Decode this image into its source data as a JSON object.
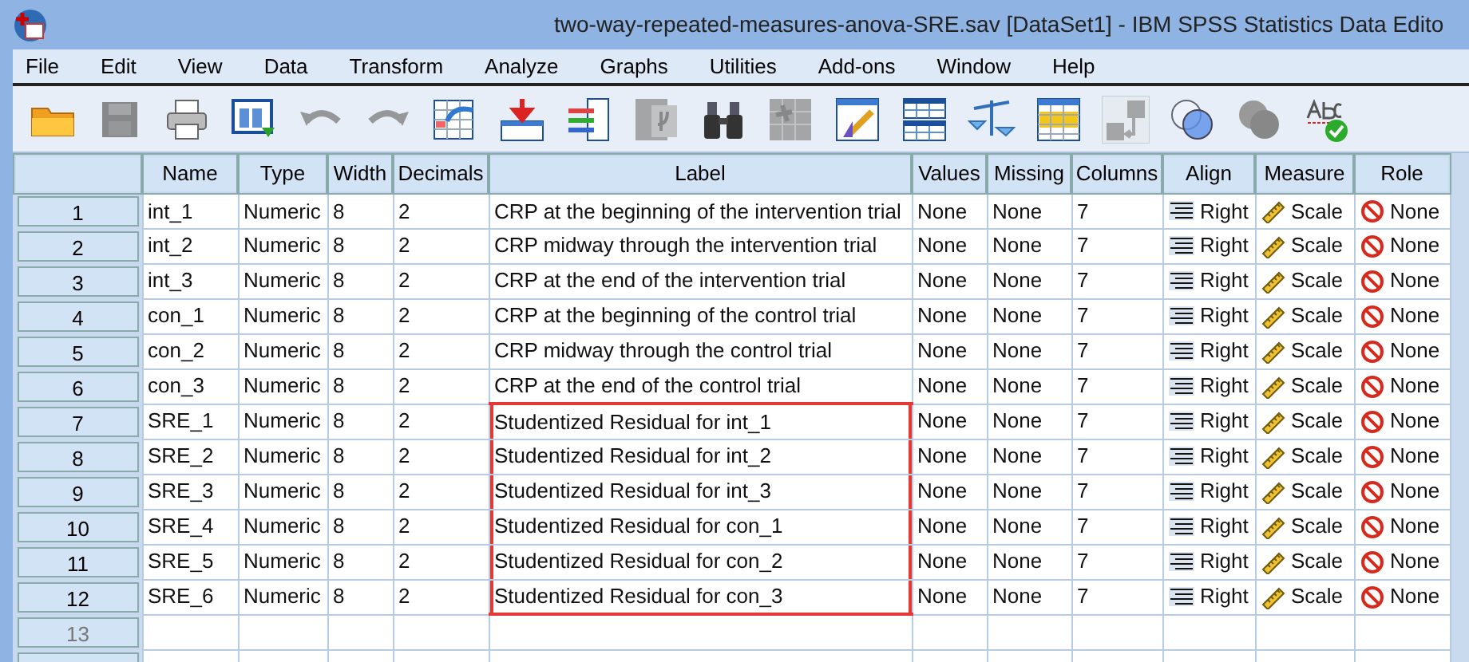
{
  "window": {
    "title": "two-way-repeated-measures-anova-SRE.sav [DataSet1] - IBM SPSS Statistics Data Edito"
  },
  "menu": [
    "File",
    "Edit",
    "View",
    "Data",
    "Transform",
    "Analyze",
    "Graphs",
    "Utilities",
    "Add-ons",
    "Window",
    "Help"
  ],
  "toolbar": [
    {
      "kind": "folder",
      "disabled": false
    },
    {
      "kind": "save",
      "disabled": true
    },
    {
      "kind": "print",
      "disabled": false
    },
    {
      "kind": "dialog",
      "disabled": false
    },
    {
      "kind": "undo",
      "disabled": true
    },
    {
      "kind": "redo",
      "disabled": true
    },
    {
      "kind": "goto",
      "disabled": false
    },
    {
      "kind": "insert",
      "disabled": false
    },
    {
      "kind": "variables",
      "disabled": false
    },
    {
      "kind": "mu",
      "disabled": true
    },
    {
      "kind": "find",
      "disabled": false
    },
    {
      "kind": "star",
      "disabled": true
    },
    {
      "kind": "pencil",
      "disabled": false
    },
    {
      "kind": "split",
      "disabled": false
    },
    {
      "kind": "scales",
      "disabled": false
    },
    {
      "kind": "select",
      "disabled": false
    },
    {
      "kind": "labels",
      "disabled": true
    },
    {
      "kind": "sets",
      "disabled": false
    },
    {
      "kind": "sets",
      "disabled": true
    },
    {
      "kind": "spell",
      "disabled": false
    }
  ],
  "table": {
    "columns": [
      "Name",
      "Type",
      "Width",
      "Decimals",
      "Label",
      "Values",
      "Missing",
      "Columns",
      "Align",
      "Measure",
      "Role"
    ],
    "rows": [
      {
        "number": "1",
        "cells": [
          "int_1",
          "Numeric",
          "8",
          "2",
          "CRP at the beginning of the intervention trial",
          "None",
          "None",
          "7",
          "Right",
          "Scale",
          "None"
        ],
        "outlined": false
      },
      {
        "number": "2",
        "cells": [
          "int_2",
          "Numeric",
          "8",
          "2",
          "CRP midway through the intervention trial",
          "None",
          "None",
          "7",
          "Right",
          "Scale",
          "None"
        ],
        "outlined": false
      },
      {
        "number": "3",
        "cells": [
          "int_3",
          "Numeric",
          "8",
          "2",
          "CRP at the end of the intervention trial",
          "None",
          "None",
          "7",
          "Right",
          "Scale",
          "None"
        ],
        "outlined": false
      },
      {
        "number": "4",
        "cells": [
          "con_1",
          "Numeric",
          "8",
          "2",
          "CRP at the beginning of the control trial",
          "None",
          "None",
          "7",
          "Right",
          "Scale",
          "None"
        ],
        "outlined": false
      },
      {
        "number": "5",
        "cells": [
          "con_2",
          "Numeric",
          "8",
          "2",
          "CRP midway through the control trial",
          "None",
          "None",
          "7",
          "Right",
          "Scale",
          "None"
        ],
        "outlined": false
      },
      {
        "number": "6",
        "cells": [
          "con_3",
          "Numeric",
          "8",
          "2",
          "CRP at the end of the control trial",
          "None",
          "None",
          "7",
          "Right",
          "Scale",
          "None"
        ],
        "outlined": false
      },
      {
        "number": "7",
        "cells": [
          "SRE_1",
          "Numeric",
          "8",
          "2",
          "Studentized Residual for int_1",
          "None",
          "None",
          "7",
          "Right",
          "Scale",
          "None"
        ],
        "outlined": true
      },
      {
        "number": "8",
        "cells": [
          "SRE_2",
          "Numeric",
          "8",
          "2",
          "Studentized Residual for int_2",
          "None",
          "None",
          "7",
          "Right",
          "Scale",
          "None"
        ],
        "outlined": true
      },
      {
        "number": "9",
        "cells": [
          "SRE_3",
          "Numeric",
          "8",
          "2",
          "Studentized Residual for int_3",
          "None",
          "None",
          "7",
          "Right",
          "Scale",
          "None"
        ],
        "outlined": true
      },
      {
        "number": "10",
        "cells": [
          "SRE_4",
          "Numeric",
          "8",
          "2",
          "Studentized Residual for con_1",
          "None",
          "None",
          "7",
          "Right",
          "Scale",
          "None"
        ],
        "outlined": true
      },
      {
        "number": "11",
        "cells": [
          "SRE_5",
          "Numeric",
          "8",
          "2",
          "Studentized Residual for con_2",
          "None",
          "None",
          "7",
          "Right",
          "Scale",
          "None"
        ],
        "outlined": true
      },
      {
        "number": "12",
        "cells": [
          "SRE_6",
          "Numeric",
          "8",
          "2",
          "Studentized Residual for con_3",
          "None",
          "None",
          "7",
          "Right",
          "Scale",
          "None"
        ],
        "outlined": true
      }
    ],
    "empty_rows": [
      {
        "number": "13"
      }
    ]
  }
}
